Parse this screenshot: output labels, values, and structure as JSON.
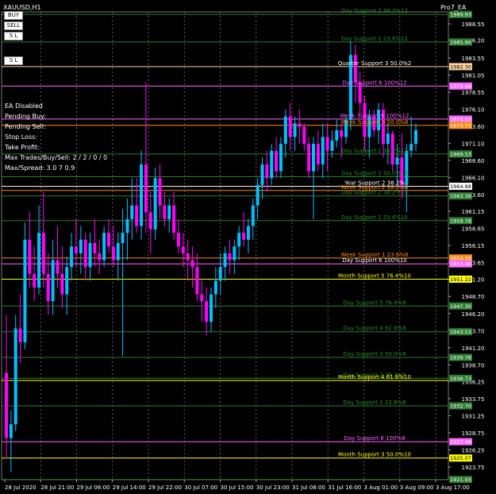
{
  "window": {
    "symbol": "XAUUSD,H1",
    "ea_name": "Pro7_EA"
  },
  "buttons": {
    "buy": "BUY",
    "sell": "SELL",
    "sl": "S L",
    "sl_line": "S L"
  },
  "info_panel": [
    "EA Disabled",
    "Pending Buy:",
    "Pending Sell:",
    "Stop Loss:",
    "Take Profit:",
    "Max Trades/Buy/Sell: 2 / 2 / 0 / 0",
    "Max/Spread: 3.0 7 0.9"
  ],
  "price_axis": {
    "ticks": [
      "1988.55",
      "1986.20",
      "1983.55",
      "1981.05",
      "1978.55",
      "1976.10",
      "1973.60",
      "1971.10",
      "1968.60",
      "1966.10",
      "1963.60",
      "1961.15",
      "1958.65",
      "1956.15",
      "1953.65",
      "1951.20",
      "1948.70",
      "1946.20",
      "1943.70",
      "1941.20",
      "1938.70",
      "1936.25",
      "1933.75",
      "1931.25",
      "1928.75",
      "1926.25",
      "1923.75"
    ],
    "ylim": [
      1921.9,
      1990.3
    ]
  },
  "time_axis": [
    "28 Jul 2020",
    "28 Jul 21:00",
    "29 Jul 06:00",
    "29 Jul 14:00",
    "29 Jul 22:00",
    "30 Jul 07:00",
    "30 Jul 15:00",
    "30 Jul 23:00",
    "31 Jul 08:00",
    "31 Jul 16:00",
    "3 Aug 01:00",
    "3 Aug 09:00",
    "3 Aug 17:00"
  ],
  "levels": [
    {
      "label": "Day Support 2 38.2%12",
      "price": 1989.93,
      "color": "#2e7d32",
      "text_color": "#2e8b2e",
      "badge": "1989.93"
    },
    {
      "label": "Day Support 1 23.6%12",
      "price": 1985.9,
      "color": "#2e7d32",
      "text_color": "#2e8b2e",
      "badge": "1985.90"
    },
    {
      "label": "Quarter Support 3 50.0%2",
      "price": 1982.3,
      "color": "#ffd39b",
      "text_color": "#ffffff",
      "badge": "1982.30"
    },
    {
      "label": "Day Support 6 100%12",
      "price": 1979.46,
      "color": "#ff66ff",
      "text_color": "#ff66ff",
      "badge": "1979.46"
    },
    {
      "label": "Week Support 6 100%12",
      "price": 1974.63,
      "color": "#ff66ff",
      "text_color": "#ff66ff",
      "badge": "1974.63"
    },
    {
      "label": "Week Support 3 50.0%8",
      "price": 1973.71,
      "color": "#ff8c1a",
      "text_color": "#ff8c1a",
      "badge": "1973.71"
    },
    {
      "label": "Day Support 2 38.2%12",
      "price": 1969.53,
      "color": "#2e7d32",
      "text_color": "#2e8b2e",
      "badge": "1969.53"
    },
    {
      "label": "Day Support 3 50.0%12",
      "price": 1966.2,
      "color": "#2e7d32",
      "text_color": "#2e8b2e",
      "badge": ""
    },
    {
      "label": "Year Support 2 38.2%",
      "price": 1964.8,
      "color": "#ffffff",
      "text_color": "#ffffff",
      "badge": "1964.88"
    },
    {
      "label": "Week Support 2 38.2%8",
      "price": 1964.2,
      "color": "#ff8c1a",
      "text_color": "#ff8c1a",
      "badge": ""
    },
    {
      "label": "Day Support 2 38.2%10",
      "price": 1963.39,
      "color": "#2e7d32",
      "text_color": "#2e8b2e",
      "badge": "1963.39"
    },
    {
      "label": "Day Support 1 23.6%10",
      "price": 1959.78,
      "color": "#2e7d32",
      "text_color": "#2e8b2e",
      "badge": "1959.78"
    },
    {
      "label": "Week Support 1 23.6%8",
      "price": 1954.32,
      "color": "#ff8c1a",
      "text_color": "#ff8c1a",
      "badge": "1954.32"
    },
    {
      "label": "Day Support 6 100%10",
      "price": 1953.46,
      "color": "#ff66ff",
      "text_color": "#ffffff",
      "badge": "1953.46"
    },
    {
      "label": "Month Support 5 76.4%10",
      "price": 1951.22,
      "color": "#ffff00",
      "text_color": "#ffff00",
      "badge": "1951.22"
    },
    {
      "label": "Day Support 5 76.4%8",
      "price": 1947.3,
      "color": "#2e7d32",
      "text_color": "#2e8b2e",
      "badge": "1947.30"
    },
    {
      "label": "Day Support 4 61.8%8",
      "price": 1943.53,
      "color": "#2e7d32",
      "text_color": "#2e8b2e",
      "badge": "1943.53"
    },
    {
      "label": "Day Support 3 50.0%8",
      "price": 1939.78,
      "color": "#2e7d32",
      "text_color": "#2e8b2e",
      "badge": "1939.78"
    },
    {
      "label": "Day Support 2 38.2%8",
      "price": 1936.73,
      "color": "#2e7d32",
      "text_color": "#2e8b2e",
      "badge": "1936.73"
    },
    {
      "label": "Month Support 4 61.8%10",
      "price": 1936.4,
      "color": "#ffff00",
      "text_color": "#ffff00",
      "badge": ""
    },
    {
      "label": "Day Support 1 23.6%8",
      "price": 1932.7,
      "color": "#2e7d32",
      "text_color": "#2e8b2e",
      "badge": "1932.70"
    },
    {
      "label": "Day Support 6 100%8",
      "price": 1927.46,
      "color": "#ff66ff",
      "text_color": "#ff66ff",
      "badge": "1927.46"
    },
    {
      "label": "Month Support 3 50.0%10",
      "price": 1925.07,
      "color": "#ffff00",
      "text_color": "#ffff00",
      "badge": "1925.07"
    },
    {
      "label": "",
      "price": 1921.93,
      "color": "#2e7d32",
      "text_color": "#2e8b2e",
      "badge": "1921.93"
    }
  ],
  "chart_data": {
    "type": "candlestick",
    "title": "XAUUSD,H1",
    "bull_color": "#00bfff",
    "bear_color": "#ff00ff",
    "grid": true,
    "candles": [
      [
        1937.5,
        1946.0,
        1925.0,
        1928.0
      ],
      [
        1928.0,
        1932.0,
        1923.0,
        1930.0
      ],
      [
        1930.0,
        1946.0,
        1929.0,
        1944.0
      ],
      [
        1944.0,
        1949.0,
        1939.0,
        1942.0
      ],
      [
        1942.0,
        1959.5,
        1941.0,
        1957.0
      ],
      [
        1957.0,
        1961.0,
        1950.0,
        1952.0
      ],
      [
        1952.0,
        1956.0,
        1948.0,
        1950.0
      ],
      [
        1950.0,
        1962.0,
        1949.0,
        1958.0
      ],
      [
        1958.0,
        1964.0,
        1950.0,
        1952.0
      ],
      [
        1952.0,
        1955.0,
        1946.0,
        1948.0
      ],
      [
        1948.0,
        1957.0,
        1946.0,
        1954.0
      ],
      [
        1954.0,
        1959.0,
        1950.0,
        1952.0
      ],
      [
        1952.0,
        1956.0,
        1947.0,
        1949.0
      ],
      [
        1949.0,
        1954.5,
        1946.0,
        1953.0
      ],
      [
        1953.0,
        1958.0,
        1951.0,
        1956.0
      ],
      [
        1956.0,
        1960.0,
        1953.0,
        1955.0
      ],
      [
        1955.0,
        1959.0,
        1952.0,
        1957.0
      ],
      [
        1957.0,
        1958.0,
        1951.0,
        1953.0
      ],
      [
        1953.0,
        1958.0,
        1951.0,
        1956.5
      ],
      [
        1956.5,
        1960.0,
        1953.0,
        1955.0
      ],
      [
        1955.0,
        1957.0,
        1952.0,
        1954.0
      ],
      [
        1954.0,
        1959.0,
        1953.0,
        1958.0
      ],
      [
        1958.0,
        1960.0,
        1955.0,
        1956.0
      ],
      [
        1956.0,
        1959.0,
        1953.0,
        1954.0
      ],
      [
        1954.0,
        1958.0,
        1951.0,
        1956.5
      ],
      [
        1956.5,
        1961.5,
        1940.0,
        1958.0
      ],
      [
        1958.0,
        1963.0,
        1954.0,
        1960.0
      ],
      [
        1960.0,
        1966.0,
        1957.0,
        1962.0
      ],
      [
        1962.0,
        1966.0,
        1958.0,
        1959.0
      ],
      [
        1959.0,
        1970.0,
        1957.0,
        1968.0
      ],
      [
        1968.0,
        1980.0,
        1958.0,
        1961.0
      ],
      [
        1961.0,
        1964.0,
        1955.0,
        1958.5
      ],
      [
        1958.5,
        1967.5,
        1957.0,
        1966.0
      ],
      [
        1966.0,
        1968.0,
        1960.0,
        1962.0
      ],
      [
        1962.0,
        1964.0,
        1959.0,
        1960.0
      ],
      [
        1960.0,
        1963.0,
        1958.0,
        1962.0
      ],
      [
        1962.0,
        1964.0,
        1957.0,
        1958.0
      ],
      [
        1958.0,
        1960.0,
        1955.0,
        1956.0
      ],
      [
        1956.0,
        1958.0,
        1953.0,
        1955.0
      ],
      [
        1955.0,
        1957.0,
        1951.0,
        1954.0
      ],
      [
        1954.0,
        1956.0,
        1950.0,
        1953.0
      ],
      [
        1953.0,
        1955.0,
        1948.0,
        1949.0
      ],
      [
        1949.0,
        1951.0,
        1945.0,
        1948.0
      ],
      [
        1948.0,
        1950.0,
        1943.0,
        1945.0
      ],
      [
        1945.0,
        1950.0,
        1943.5,
        1949.0
      ],
      [
        1949.0,
        1953.0,
        1947.0,
        1951.0
      ],
      [
        1951.0,
        1955.0,
        1949.0,
        1953.0
      ],
      [
        1953.0,
        1956.0,
        1951.0,
        1955.0
      ],
      [
        1955.0,
        1957.0,
        1952.0,
        1954.0
      ],
      [
        1954.0,
        1957.0,
        1952.0,
        1956.0
      ],
      [
        1956.0,
        1959.0,
        1954.0,
        1958.0
      ],
      [
        1958.0,
        1961.0,
        1956.0,
        1957.0
      ],
      [
        1957.0,
        1960.0,
        1955.0,
        1959.0
      ],
      [
        1959.0,
        1963.0,
        1957.0,
        1962.0
      ],
      [
        1962.0,
        1966.0,
        1960.0,
        1965.0
      ],
      [
        1965.0,
        1969.0,
        1963.0,
        1968.0
      ],
      [
        1968.0,
        1970.0,
        1964.0,
        1966.0
      ],
      [
        1966.0,
        1971.0,
        1965.0,
        1970.0
      ],
      [
        1970.0,
        1972.0,
        1966.0,
        1967.0
      ],
      [
        1967.0,
        1972.0,
        1966.0,
        1971.0
      ],
      [
        1971.0,
        1976.0,
        1969.0,
        1975.0
      ],
      [
        1975.0,
        1977.0,
        1970.0,
        1972.0
      ],
      [
        1972.0,
        1975.0,
        1970.0,
        1974.0
      ],
      [
        1974.0,
        1976.0,
        1971.0,
        1973.5
      ],
      [
        1973.5,
        1974.0,
        1970.0,
        1971.0
      ],
      [
        1971.0,
        1972.0,
        1966.0,
        1967.0
      ],
      [
        1967.0,
        1972.0,
        1960.0,
        1971.0
      ],
      [
        1971.0,
        1973.0,
        1967.0,
        1968.0
      ],
      [
        1968.0,
        1974.0,
        1966.0,
        1972.0
      ],
      [
        1972.0,
        1974.0,
        1967.0,
        1970.0
      ],
      [
        1970.0,
        1973.0,
        1969.0,
        1971.5
      ],
      [
        1971.5,
        1974.5,
        1970.5,
        1973.0
      ],
      [
        1973.0,
        1974.0,
        1969.0,
        1972.0
      ],
      [
        1972.0,
        1975.0,
        1971.0,
        1974.5
      ],
      [
        1974.5,
        1986.0,
        1973.0,
        1984.0
      ],
      [
        1984.0,
        1985.5,
        1977.0,
        1980.0
      ],
      [
        1980.0,
        1981.5,
        1975.0,
        1977.0
      ],
      [
        1977.0,
        1978.0,
        1970.0,
        1972.0
      ],
      [
        1972.0,
        1976.0,
        1969.0,
        1975.0
      ],
      [
        1975.0,
        1976.0,
        1972.0,
        1973.0
      ],
      [
        1973.0,
        1977.0,
        1971.0,
        1976.0
      ],
      [
        1976.0,
        1977.0,
        1969.0,
        1971.0
      ],
      [
        1971.0,
        1974.0,
        1968.0,
        1972.5
      ],
      [
        1972.5,
        1973.0,
        1967.0,
        1968.0
      ],
      [
        1968.0,
        1971.0,
        1965.0,
        1969.0
      ],
      [
        1969.0,
        1972.5,
        1963.0,
        1965.0
      ],
      [
        1965.0,
        1971.0,
        1961.0,
        1970.0
      ],
      [
        1970.0,
        1975.0,
        1969.0,
        1971.0
      ],
      [
        1971.0,
        1974.0,
        1970.0,
        1973.0
      ]
    ]
  }
}
